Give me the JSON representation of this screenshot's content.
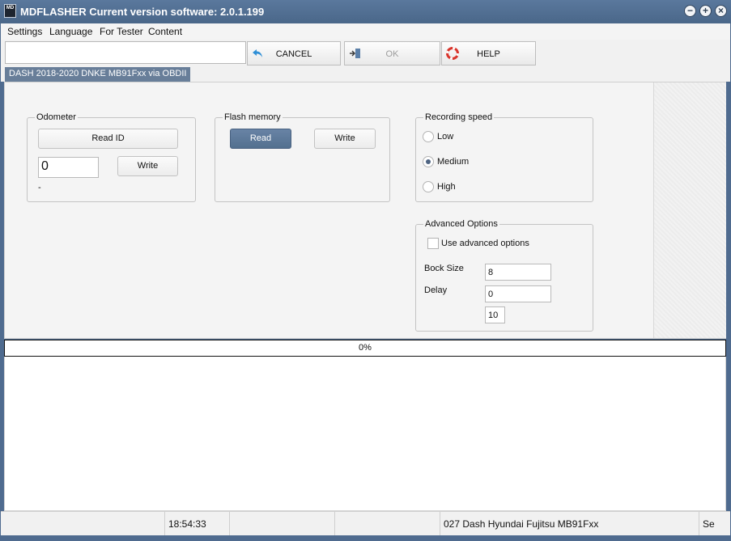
{
  "window": {
    "icon_text": "MD",
    "title": "MDFLASHER  Current version software: 2.0.1.199",
    "controls": {
      "minimize": "−",
      "maximize": "+",
      "close": "×"
    }
  },
  "menu": {
    "items": [
      "Settings",
      "Language",
      "For Tester",
      "Content"
    ]
  },
  "toolbar": {
    "input_value": "",
    "cancel_label": "CANCEL",
    "ok_label": "OK",
    "help_label": "HELP"
  },
  "tab": {
    "label": "DASH 2018-2020 DNKE MB91Fxx via OBDII"
  },
  "odometer": {
    "title": "Odometer",
    "read_id_label": "Read ID",
    "value": "0",
    "write_label": "Write",
    "status": "-"
  },
  "flash": {
    "title": "Flash memory",
    "read_label": "Read",
    "write_label": "Write"
  },
  "recording": {
    "title": "Recording speed",
    "options": [
      "Low",
      "Medium",
      "High"
    ],
    "selected": "Medium"
  },
  "advanced": {
    "title": "Advanced Options",
    "checkbox_label": "Use advanced options",
    "checked": false,
    "block_size_label": "Bock Size",
    "block_size_value": "8",
    "delay_label": "Delay",
    "delay_value": "0",
    "extra_value": "10"
  },
  "progress": {
    "text": "0%",
    "fraction": 0
  },
  "statusbar": {
    "time": "18:54:33",
    "device": "027 Dash Hyundai Fujitsu MB91Fxx",
    "last": "Se"
  },
  "colors": {
    "accent": "#53708f",
    "titlebar": "#4f6b8f",
    "tab": "#687e99"
  }
}
